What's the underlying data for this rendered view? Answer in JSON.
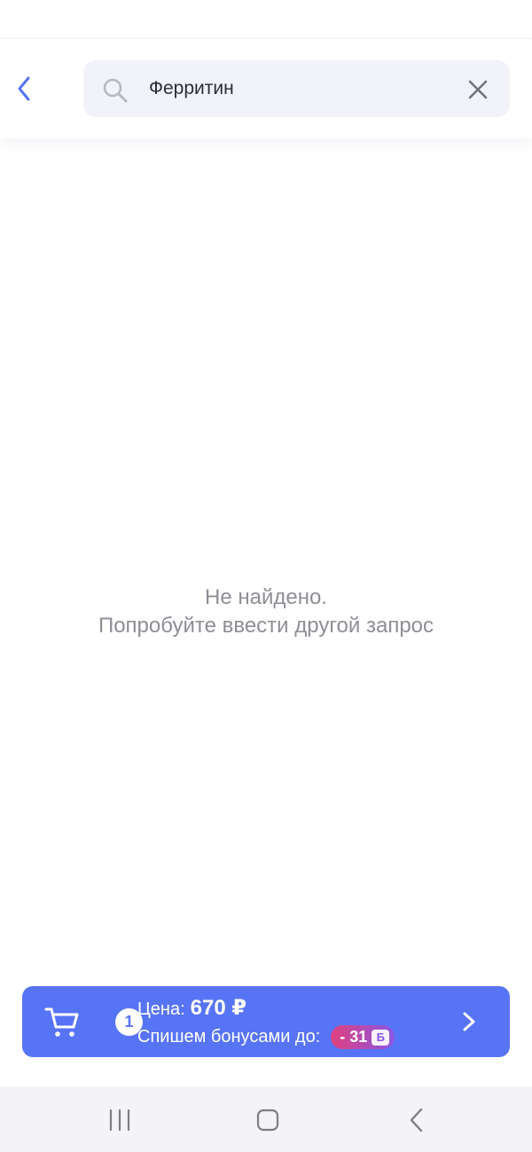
{
  "search": {
    "query": "Ферритин"
  },
  "empty_state": {
    "line1": "Не найдено.",
    "line2": "Попробуйте ввести другой запрос"
  },
  "cart": {
    "count": "1",
    "price_label": "Цена:",
    "price_value": "670 ₽",
    "bonus_label": "Спишем бонусами до:",
    "bonus_value": "- 31",
    "bonus_unit": "Б"
  },
  "icons": {
    "back": "chevron-left-icon",
    "search": "search-icon",
    "clear": "close-icon",
    "cart": "cart-icon",
    "proceed": "chevron-right-icon",
    "nav_recent": "recent-apps-icon",
    "nav_home": "home-icon",
    "nav_back": "back-icon"
  },
  "colors": {
    "accent": "#5874f6",
    "search_bg": "#f1f3f8",
    "muted_text": "#8d8f95",
    "bonus_gradient_start": "#e0407e",
    "bonus_gradient_end": "#8a56e3"
  }
}
